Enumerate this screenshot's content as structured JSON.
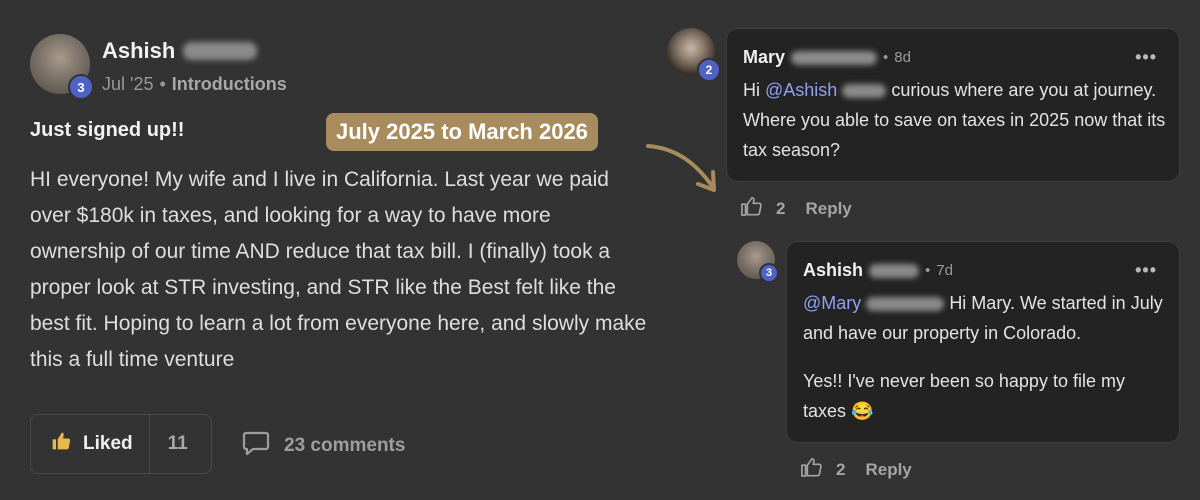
{
  "post": {
    "author": "Ashish",
    "avatar_badge": "3",
    "date": "Jul '25",
    "separator": "•",
    "category": "Introductions",
    "title": "Just signed up!!",
    "body": "HI everyone! My wife and I live in California. Last year we paid over $180k in taxes, and looking for a way to have more ownership of our time AND reduce that tax bill. I (finally) took a proper look at STR investing, and STR like the Best felt like the best fit. Hoping to learn a lot from everyone here, and slowly make this a full time venture",
    "like_label": "Liked",
    "like_count": "11",
    "comments_label": "23 comments",
    "like_icon": "thumbs-up-icon",
    "comment_icon": "speech-bubble-icon"
  },
  "annotation": {
    "label": "July 2025 to March 2026",
    "color": "#a88c5e"
  },
  "comments": [
    {
      "author": "Mary",
      "avatar_badge": "2",
      "separator": "•",
      "time": "8d",
      "more": "•••",
      "text_prefix": "Hi ",
      "mention": "@Ashish",
      "text_rest": "curious where are you at journey. Where you able to save on taxes in 2025 now that its tax season?",
      "like_count": "2",
      "reply_label": "Reply"
    },
    {
      "author": "Ashish",
      "avatar_badge": "3",
      "separator": "•",
      "time": "7d",
      "more": "•••",
      "mention": "@Mary",
      "text_rest": "Hi Mary. We started in July and have our property in Colorado.",
      "text_second": "Yes!! I've never been so happy to file my taxes",
      "emoji": "😂",
      "like_count": "2",
      "reply_label": "Reply"
    }
  ],
  "colors": {
    "background": "#333333",
    "card": "#232323",
    "mention": "#8ea2f2",
    "badge": "#4f63c7"
  }
}
